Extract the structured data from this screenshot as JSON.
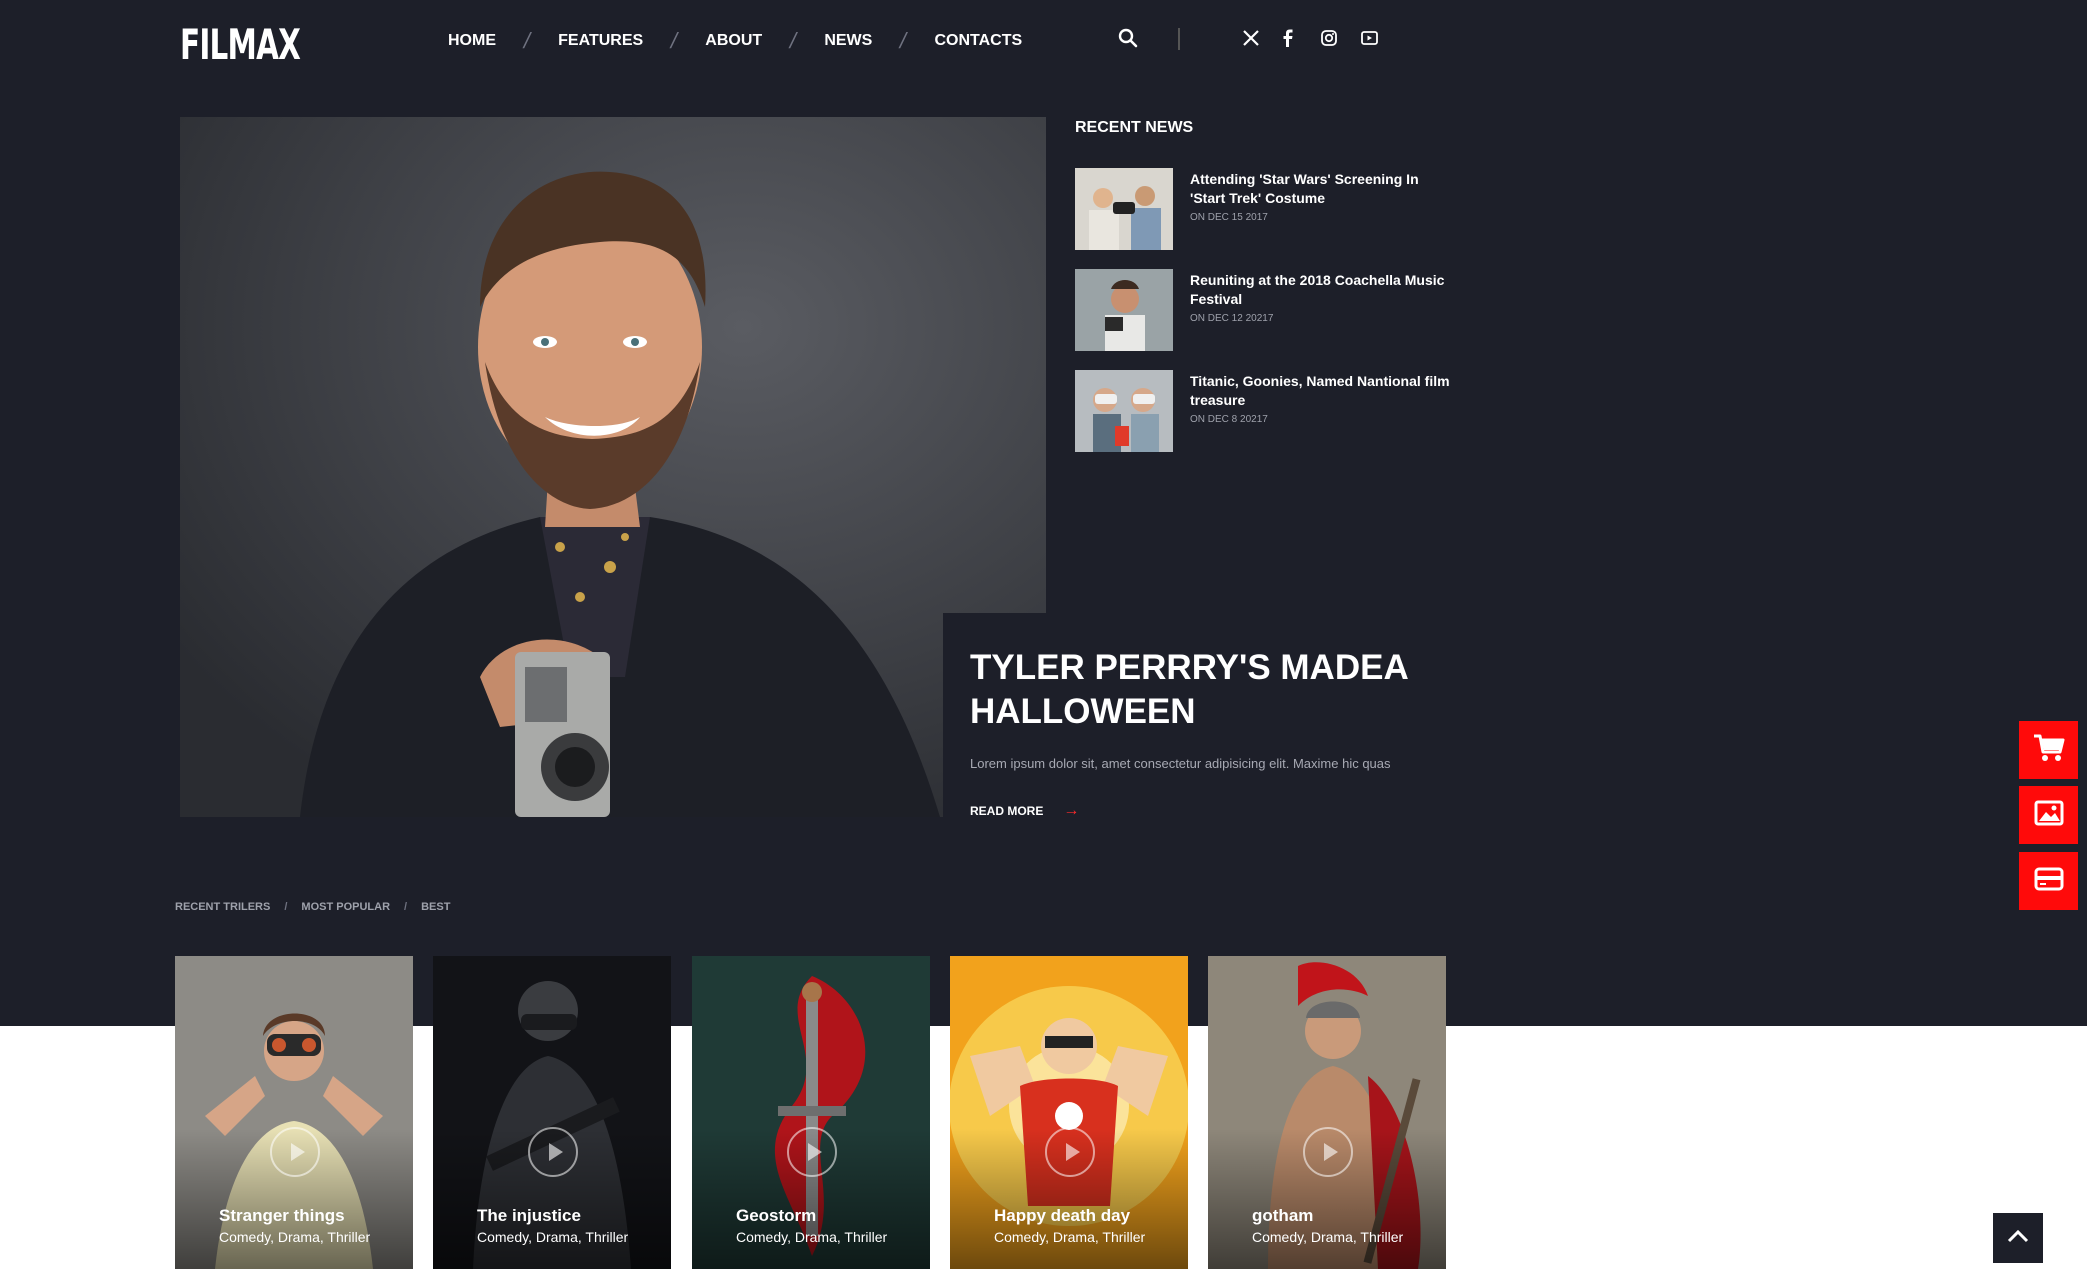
{
  "brand": {
    "logo": "FILMAX"
  },
  "nav": {
    "items": [
      "HOME",
      "FEATURES",
      "ABOUT",
      "NEWS",
      "CONTACTS"
    ],
    "separator": "/"
  },
  "social_icons": [
    "x-icon",
    "facebook-icon",
    "instagram-icon",
    "youtube-icon"
  ],
  "hero": {
    "title": "TYLER PERRRY'S MADEA HALLOWEEN",
    "description": "Lorem ipsum dolor sit, amet consectetur adipisicing elit. Maxime hic quas",
    "read_more": "READ MORE",
    "read_more_arrow": "→"
  },
  "recent_news": {
    "heading": "RECENT NEWS",
    "items": [
      {
        "title": "Attending 'Star Wars' Screening In 'Start Trek' Costume",
        "date": "ON DEC 15 2017"
      },
      {
        "title": "Reuniting at the 2018 Coachella Music Festival",
        "date": "ON DEC 12 20217"
      },
      {
        "title": "Titanic, Goonies, Named Nantional film treasure",
        "date": "ON DEC 8 20217"
      }
    ]
  },
  "trailer_tabs": {
    "items": [
      "RECENT TRILERS",
      "MOST POPULAR",
      "BEST"
    ],
    "separator": "/"
  },
  "movies": [
    {
      "title": "Stranger things",
      "genres": "Comedy, Drama, Thriller"
    },
    {
      "title": "The injustice",
      "genres": "Comedy, Drama, Thriller"
    },
    {
      "title": "Geostorm",
      "genres": "Comedy, Drama, Thriller"
    },
    {
      "title": "Happy death day",
      "genres": "Comedy, Drama, Thriller"
    },
    {
      "title": "gotham",
      "genres": "Comedy, Drama, Thriller"
    }
  ],
  "side_buttons": [
    "cart-icon",
    "gallery-icon",
    "card-icon"
  ],
  "colors": {
    "background": "#1d1f29",
    "accent": "#ff0a0a",
    "muted_text": "#9ea1ab"
  }
}
